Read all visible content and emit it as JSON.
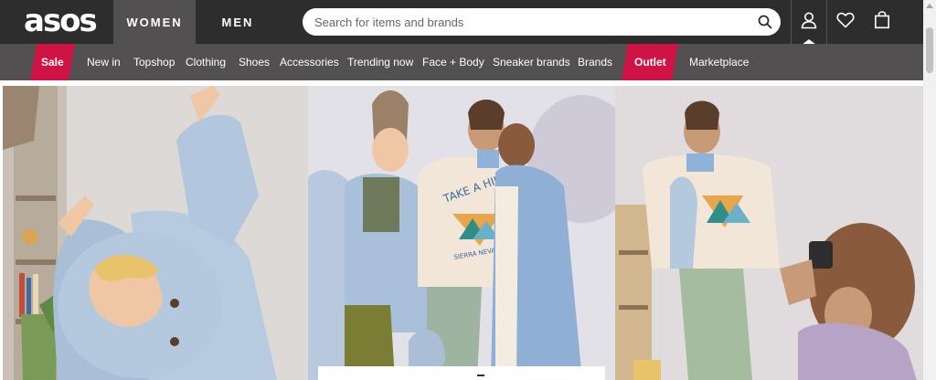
{
  "header": {
    "logo": "asos",
    "tabs": [
      {
        "label": "WOMEN",
        "active": true
      },
      {
        "label": "MEN",
        "active": false
      }
    ],
    "search": {
      "placeholder": "Search for items and brands",
      "value": ""
    },
    "icons": [
      "search-icon",
      "account-icon",
      "heart-icon",
      "bag-icon"
    ]
  },
  "nav": {
    "items": [
      {
        "label": "Sale",
        "highlight": true
      },
      {
        "label": "New in",
        "highlight": false
      },
      {
        "label": "Topshop",
        "highlight": false
      },
      {
        "label": "Clothing",
        "highlight": false
      },
      {
        "label": "Shoes",
        "highlight": false
      },
      {
        "label": "Accessories",
        "highlight": false
      },
      {
        "label": "Trending now",
        "highlight": false
      },
      {
        "label": "Face + Body",
        "highlight": false
      },
      {
        "label": "Sneaker brands",
        "highlight": false
      },
      {
        "label": "Brands",
        "highlight": false
      },
      {
        "label": "Outlet",
        "highlight": true
      },
      {
        "label": "Marketplace",
        "highlight": false
      }
    ]
  },
  "hero": {
    "sweatshirt_text": "TAKE A HIKE",
    "sweatshirt_subtext": "SIERRA NEVADA"
  },
  "colors": {
    "header_bg": "#2d2d2d",
    "nav_bg": "#525050",
    "sale_red": "#d01345",
    "white": "#ffffff"
  }
}
